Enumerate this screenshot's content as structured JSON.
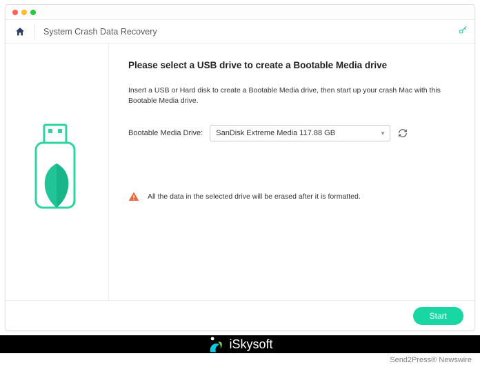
{
  "window": {
    "title": "System Crash Data Recovery"
  },
  "main": {
    "heading": "Please select a USB drive to create a Bootable Media drive",
    "instruction": "Insert a USB or Hard disk to create a Bootable Media drive, then start up your crash Mac with this Bootable Media drive.",
    "drive_label": "Bootable Media Drive:",
    "selected_drive": "SanDisk Extreme Media 117.88 GB",
    "warning": "All the data in the selected drive will be erased after it is formatted."
  },
  "actions": {
    "start_label": "Start"
  },
  "brand": {
    "name": "iSkysoft"
  },
  "footer": {
    "credit": "Send2Press® Newswire"
  }
}
